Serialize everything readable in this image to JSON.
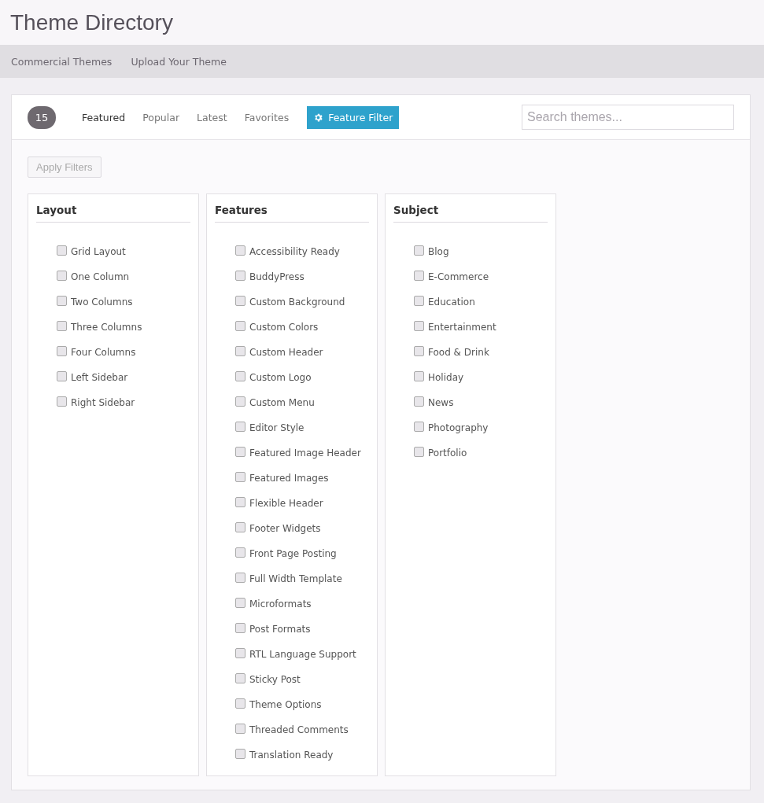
{
  "title": "Theme Directory",
  "nav": [
    {
      "label": "Commercial Themes"
    },
    {
      "label": "Upload Your Theme"
    }
  ],
  "count": "15",
  "tabs": [
    {
      "label": "Featured",
      "selected": true
    },
    {
      "label": "Popular",
      "selected": false
    },
    {
      "label": "Latest",
      "selected": false
    },
    {
      "label": "Favorites",
      "selected": false
    }
  ],
  "filter_button": {
    "label": "Feature Filter",
    "selected": true
  },
  "search": {
    "placeholder": "Search themes..."
  },
  "apply_button": {
    "label": "Apply Filters",
    "disabled": true
  },
  "groups": [
    {
      "title": "Layout",
      "items": [
        {
          "label": "Grid Layout",
          "checked": false
        },
        {
          "label": "One Column",
          "checked": false
        },
        {
          "label": "Two Columns",
          "checked": false
        },
        {
          "label": "Three Columns",
          "checked": false
        },
        {
          "label": "Four Columns",
          "checked": false
        },
        {
          "label": "Left Sidebar",
          "checked": false
        },
        {
          "label": "Right Sidebar",
          "checked": false
        }
      ]
    },
    {
      "title": "Features",
      "items": [
        {
          "label": "Accessibility Ready",
          "checked": false
        },
        {
          "label": "BuddyPress",
          "checked": false
        },
        {
          "label": "Custom Background",
          "checked": false
        },
        {
          "label": "Custom Colors",
          "checked": false
        },
        {
          "label": "Custom Header",
          "checked": false
        },
        {
          "label": "Custom Logo",
          "checked": false
        },
        {
          "label": "Custom Menu",
          "checked": false
        },
        {
          "label": "Editor Style",
          "checked": false
        },
        {
          "label": "Featured Image Header",
          "checked": false
        },
        {
          "label": "Featured Images",
          "checked": false
        },
        {
          "label": "Flexible Header",
          "checked": false
        },
        {
          "label": "Footer Widgets",
          "checked": false
        },
        {
          "label": "Front Page Posting",
          "checked": false
        },
        {
          "label": "Full Width Template",
          "checked": false
        },
        {
          "label": "Microformats",
          "checked": false
        },
        {
          "label": "Post Formats",
          "checked": false
        },
        {
          "label": "RTL Language Support",
          "checked": false
        },
        {
          "label": "Sticky Post",
          "checked": false
        },
        {
          "label": "Theme Options",
          "checked": false
        },
        {
          "label": "Threaded Comments",
          "checked": false
        },
        {
          "label": "Translation Ready",
          "checked": false
        }
      ]
    },
    {
      "title": "Subject",
      "items": [
        {
          "label": "Blog",
          "checked": false
        },
        {
          "label": "E-Commerce",
          "checked": false
        },
        {
          "label": "Education",
          "checked": false
        },
        {
          "label": "Entertainment",
          "checked": false
        },
        {
          "label": "Food & Drink",
          "checked": false
        },
        {
          "label": "Holiday",
          "checked": false
        },
        {
          "label": "News",
          "checked": false
        },
        {
          "label": "Photography",
          "checked": false
        },
        {
          "label": "Portfolio",
          "checked": false
        }
      ]
    }
  ]
}
